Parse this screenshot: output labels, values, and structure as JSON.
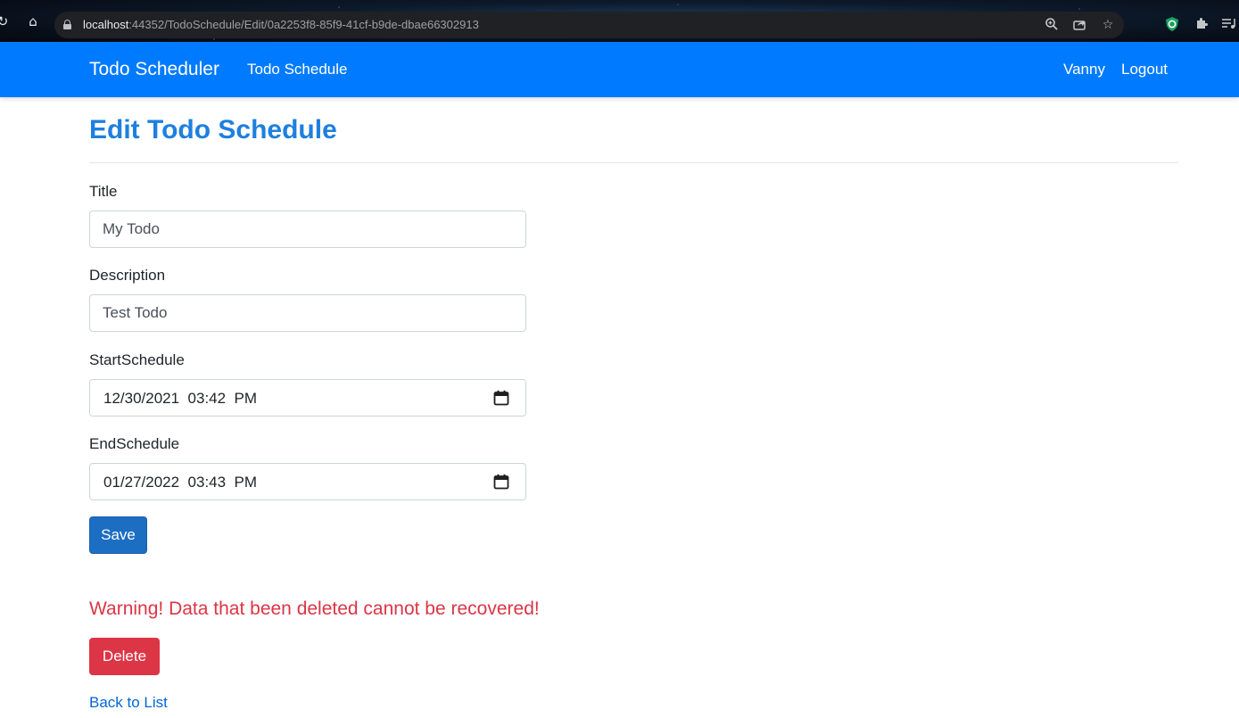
{
  "browser": {
    "url_host": "localhost",
    "url_path": ":44352/TodoSchedule/Edit/0a2253f8-85f9-41cf-b9de-dbae66302913",
    "icons": [
      "reload-icon",
      "home-icon",
      "lock-icon",
      "zoom-icon",
      "share-icon",
      "star-icon",
      "shield-extension-icon",
      "puzzle-icon",
      "playlist-icon"
    ]
  },
  "navbar": {
    "brand": "Todo Scheduler",
    "link_schedule": "Todo Schedule",
    "user": "Vanny",
    "logout": "Logout",
    "color": "#007bff"
  },
  "page": {
    "title": "Edit Todo Schedule"
  },
  "form": {
    "title_label": "Title",
    "title_value": "My Todo",
    "description_label": "Description",
    "description_value": "Test Todo",
    "start_label": "StartSchedule",
    "start_value": "12/30/2021  03:42  PM",
    "end_label": "EndSchedule",
    "end_value": "01/27/2022  03:43  PM",
    "save_label": "Save"
  },
  "delete_section": {
    "warning": "Warning! Data that been deleted cannot be recovered!",
    "delete_label": "Delete",
    "back_link": "Back to List",
    "warning_color": "#dc3545"
  }
}
